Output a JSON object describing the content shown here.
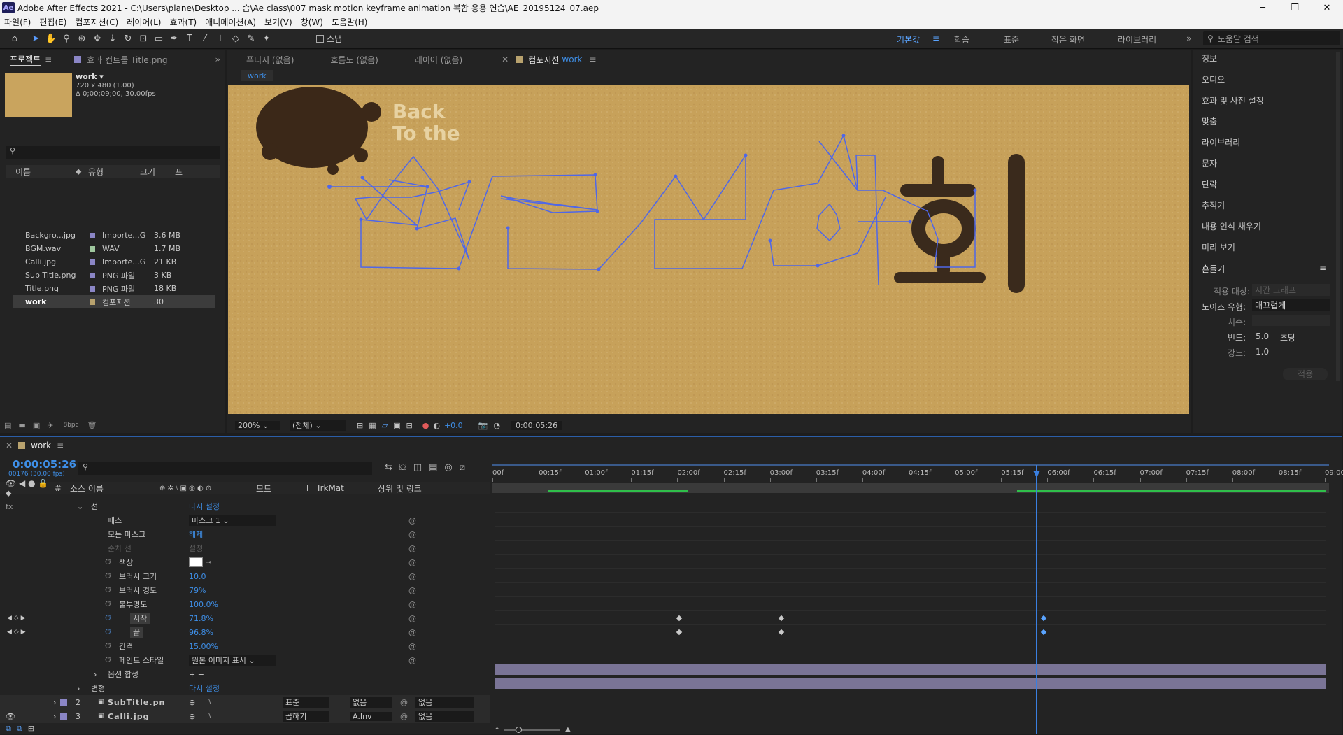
{
  "app": {
    "title": "Adobe After Effects 2021 - C:\\Users\\plane\\Desktop ... 습\\Ae class\\007 mask motion keyframe animation 복합 응용 연습\\AE_20195124_07.aep",
    "logo": "Ae"
  },
  "menu": [
    "파일(F)",
    "편집(E)",
    "컴포지션(C)",
    "레이어(L)",
    "효과(T)",
    "애니메이션(A)",
    "보기(V)",
    "창(W)",
    "도움말(H)"
  ],
  "workspaces": {
    "active": "기본값",
    "items": [
      "학습",
      "표준",
      "작은 화면",
      "라이브러리"
    ],
    "search_placeholder": "도움말 검색",
    "snap": "스냅"
  },
  "project": {
    "tab": "프로젝트",
    "effects_tab": "효과 컨트롤 Title.png",
    "comp_name": "work ▾",
    "comp_size": "720 x 480 (1.00)",
    "comp_duration": "Δ 0;00;09;00, 30.00fps",
    "headers": {
      "name": "이름",
      "type": "유형",
      "size": "크기",
      "fr": "프"
    },
    "items": [
      {
        "name": "Backgro...jpg",
        "type": "Importe...G",
        "size": "3.6 MB",
        "color": "#8b86c6"
      },
      {
        "name": "BGM.wav",
        "type": "WAV",
        "size": "1.7 MB",
        "color": "#9fc79e"
      },
      {
        "name": "Calli.jpg",
        "type": "Importe...G",
        "size": "21 KB",
        "color": "#8b86c6"
      },
      {
        "name": "Sub Title.png",
        "type": "PNG 파일",
        "size": "3 KB",
        "color": "#8b86c6"
      },
      {
        "name": "Title.png",
        "type": "PNG 파일",
        "size": "18 KB",
        "color": "#8b86c6"
      },
      {
        "name": "work",
        "type": "컴포지션",
        "size": "30",
        "color": "#b8a26e"
      }
    ],
    "bpc": "8bpc"
  },
  "viewer": {
    "tabs": [
      "푸티지 (없음)",
      "흐름도 (없음)",
      "레이어 (없음)"
    ],
    "comp_tab": "컴포지션",
    "comp_tab_name": "work",
    "breadcrumb": "work",
    "zoom": "200%",
    "resolution": "(전체)",
    "exposure": "+0.0",
    "timecode": "0:00:05:26",
    "logo_text_1": "Back",
    "logo_text_2": "To the"
  },
  "right_panel": {
    "items": [
      "정보",
      "오디오",
      "효과 및 사전 설정",
      "맞춤",
      "라이브러리",
      "문자",
      "단락",
      "추적기",
      "내용 인식 채우기",
      "미리 보기"
    ],
    "wiggle": {
      "title": "흔들기",
      "apply_to_label": "적용 대상:",
      "apply_to": "시간 그래프",
      "noise_label": "노이즈 유형:",
      "noise": "매끄럽게",
      "dim_label": "치수:",
      "freq_label": "빈도:",
      "freq": "5.0",
      "freq_unit": "초당",
      "mag_label": "강도:",
      "mag": "1.0",
      "apply": "적용"
    }
  },
  "timeline": {
    "tab": "work",
    "timecode": "0:00:05:26",
    "frames": "00176 (30.00 fps)",
    "headers": {
      "source": "소스 이름",
      "mode": "모드",
      "t": "T",
      "trkmat": "TrkMat",
      "parent": "상위 및 링크"
    },
    "ruler": [
      "00f",
      "00:15f",
      "01:00f",
      "01:15f",
      "02:00f",
      "02:15f",
      "03:00f",
      "03:15f",
      "04:00f",
      "04:15f",
      "05:00f",
      "05:15f",
      "06:00f",
      "06:15f",
      "07:00f",
      "07:15f",
      "08:00f",
      "08:15f",
      "09:00f"
    ],
    "props": [
      {
        "label": "선",
        "value": "다시 설정",
        "indent": 0,
        "twirl": true
      },
      {
        "label": "패스",
        "value": "마스크 1",
        "indent": 1,
        "dropdown": true
      },
      {
        "label": "모든 마스크",
        "value": "해제",
        "indent": 1
      },
      {
        "label": "순차 선",
        "value": "설정",
        "indent": 1,
        "dim": true
      },
      {
        "label": "색상",
        "value": "",
        "indent": 1,
        "stopwatch": true,
        "color": true
      },
      {
        "label": "브러시 크기",
        "value": "10.0",
        "indent": 1,
        "stopwatch": true
      },
      {
        "label": "브러시 경도",
        "value": "79%",
        "indent": 1,
        "stopwatch": true
      },
      {
        "label": "불투명도",
        "value": "100.0%",
        "indent": 1,
        "stopwatch": true
      },
      {
        "label": "시작",
        "value": "71.8%",
        "indent": 1,
        "stopwatch": true,
        "keyed": true
      },
      {
        "label": "끝",
        "value": "96.8%",
        "indent": 1,
        "stopwatch": true,
        "keyed": true
      },
      {
        "label": "간격",
        "value": "15.00%",
        "indent": 1,
        "stopwatch": true
      },
      {
        "label": "페인트 스타일",
        "value": "원본 이미지 표시",
        "indent": 1,
        "stopwatch": true,
        "dropdown": true
      },
      {
        "label": "옵션 합성",
        "value": "",
        "indent": 1,
        "twirl": true
      },
      {
        "label": "변형",
        "value": "다시 설정",
        "indent": 0,
        "twirl": true
      }
    ],
    "layers": [
      {
        "num": "2",
        "name": "SubTitle.pn",
        "mode": "표준",
        "trkmat": "없음",
        "parent": "없음"
      },
      {
        "num": "3",
        "name": "Calli.jpg",
        "mode": "곱하기",
        "trkmat": "A.Inv",
        "parent": "없음"
      }
    ]
  }
}
